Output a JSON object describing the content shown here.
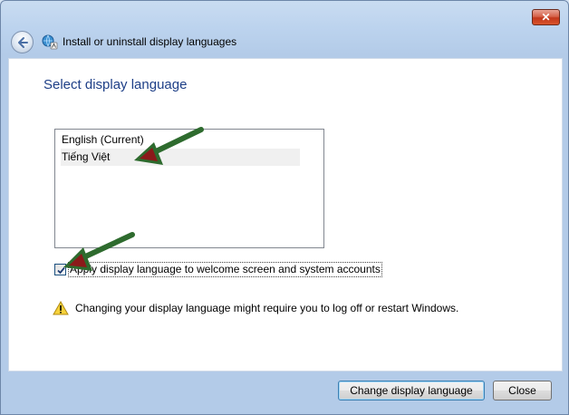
{
  "window": {
    "title": "Install or uninstall display languages",
    "close_label": "✕"
  },
  "page": {
    "heading": "Select display language"
  },
  "languages": [
    {
      "label": "English (Current)"
    },
    {
      "label": "Tiếng Việt"
    }
  ],
  "checkbox": {
    "label": "Apply display language to welcome screen and system accounts",
    "checked": true
  },
  "warning": {
    "text": "Changing your display language might require you to log off or restart Windows."
  },
  "buttons": {
    "change_label": "Change display language",
    "close_label": "Close"
  },
  "colors": {
    "heading": "#1e3f87",
    "arrow_fill": "#2e6b2e",
    "arrow_head": "#8b1a1a"
  }
}
